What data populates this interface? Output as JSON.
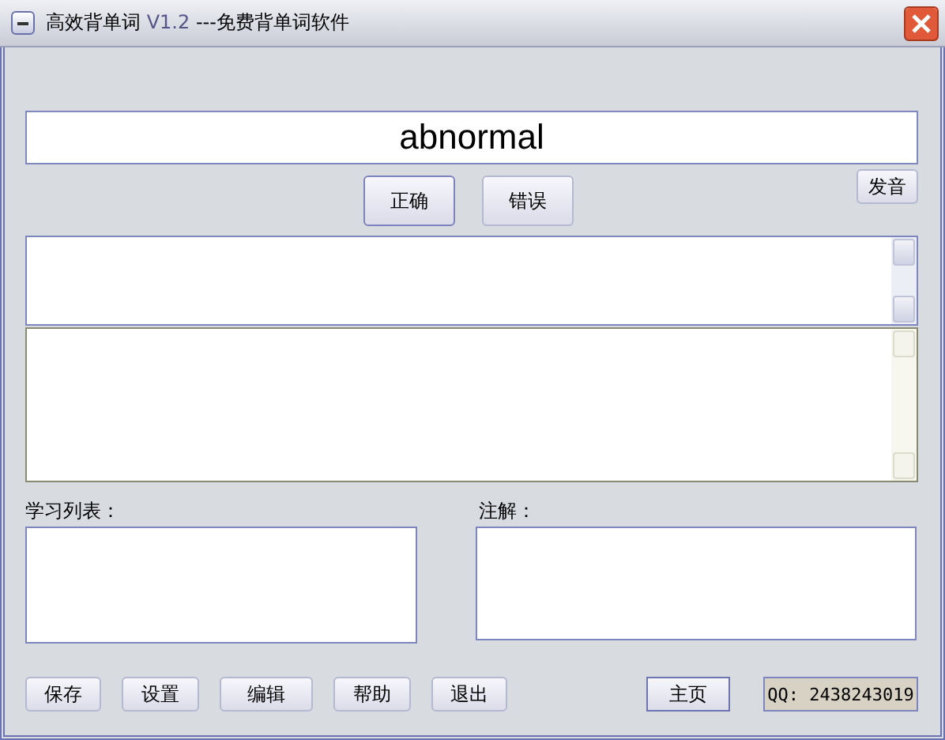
{
  "window": {
    "title": "高效背单词",
    "version": "V1.2",
    "subtitle": "---免费背单词软件"
  },
  "word": "abnormal",
  "answer_buttons": [
    "正确",
    "错误"
  ],
  "pronounce_button": "发音",
  "study_list": {
    "label": "学习列表："
  },
  "notes": {
    "label": "注解："
  },
  "bottom_buttons": [
    "保存",
    "设置",
    "编辑",
    "帮助",
    "退出"
  ],
  "home_button": "主页",
  "qq": "QQ: 2438243019"
}
